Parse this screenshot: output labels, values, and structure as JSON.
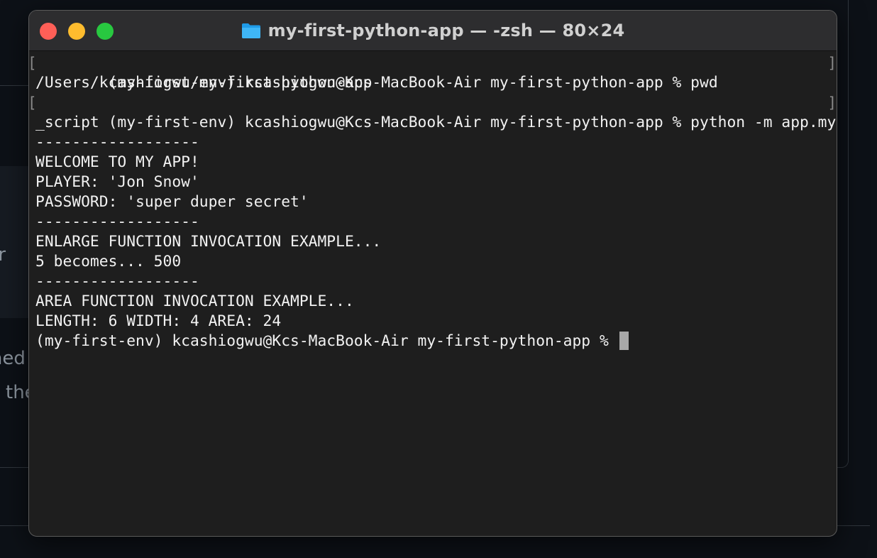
{
  "window": {
    "title": "my-first-python-app — -zsh — 80×24",
    "folder_icon": "folder-icon",
    "colors": {
      "close": "#fe5f57",
      "minimize": "#febc2e",
      "maximize": "#28c840"
    }
  },
  "background": {
    "fragments": [
      "tir",
      "med",
      "the"
    ]
  },
  "terminal": {
    "lines": [
      "(my-first-env) kcashiogwu@Kcs-MacBook-Air my-first-python-app % pwd",
      "/Users/kcashiogwu/my-first-python-app",
      "(my-first-env) kcashiogwu@Kcs-MacBook-Air my-first-python-app % python -m app.my",
      "_script",
      "------------------",
      "WELCOME TO MY APP!",
      "PLAYER: 'Jon Snow'",
      "PASSWORD: 'super duper secret'",
      "------------------",
      "ENLARGE FUNCTION INVOCATION EXAMPLE...",
      "5 becomes... 500",
      "------------------",
      "AREA FUNCTION INVOCATION EXAMPLE...",
      "LENGTH: 6 WIDTH: 4 AREA: 24"
    ],
    "prompt": "(my-first-env) kcashiogwu@Kcs-MacBook-Air my-first-python-app % ",
    "bracket_left": "[",
    "bracket_right": "]"
  }
}
